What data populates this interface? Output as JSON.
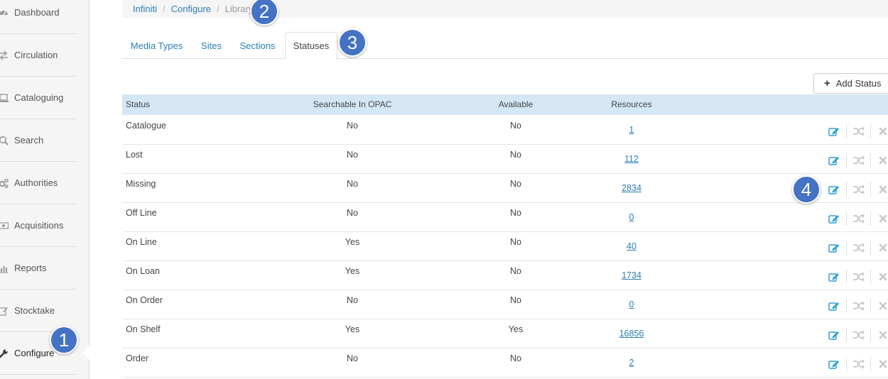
{
  "sidebar": {
    "items": [
      {
        "label": "Dashboard",
        "icon": "dashboard-icon"
      },
      {
        "label": "Circulation",
        "icon": "exchange-icon"
      },
      {
        "label": "Cataloguing",
        "icon": "laptop-icon"
      },
      {
        "label": "Search",
        "icon": "search-icon"
      },
      {
        "label": "Authorities",
        "icon": "cogs-icon"
      },
      {
        "label": "Acquisitions",
        "icon": "money-icon"
      },
      {
        "label": "Reports",
        "icon": "bar-chart-icon"
      },
      {
        "label": "Stocktake",
        "icon": "edit-icon"
      },
      {
        "label": "Configure",
        "icon": "wrench-icon",
        "active": true
      }
    ]
  },
  "breadcrumb": {
    "items": [
      "Infiniti",
      "Configure"
    ],
    "current": "Library"
  },
  "tabs": [
    {
      "label": "Media Types"
    },
    {
      "label": "Sites"
    },
    {
      "label": "Sections"
    },
    {
      "label": "Statuses",
      "active": true
    }
  ],
  "toolbar": {
    "add_label": "Add Status"
  },
  "table": {
    "headers": [
      "Status",
      "Searchable In OPAC",
      "Available",
      "Resources"
    ],
    "rows": [
      {
        "status": "Catalogue",
        "searchable": "No",
        "available": "No",
        "resources": "1"
      },
      {
        "status": "Lost",
        "searchable": "No",
        "available": "No",
        "resources": "112"
      },
      {
        "status": "Missing",
        "searchable": "No",
        "available": "No",
        "resources": "2834"
      },
      {
        "status": "Off Line",
        "searchable": "No",
        "available": "No",
        "resources": "0"
      },
      {
        "status": "On Line",
        "searchable": "Yes",
        "available": "No",
        "resources": "40"
      },
      {
        "status": "On Loan",
        "searchable": "Yes",
        "available": "No",
        "resources": "1734"
      },
      {
        "status": "On Order",
        "searchable": "No",
        "available": "No",
        "resources": "0"
      },
      {
        "status": "On Shelf",
        "searchable": "Yes",
        "available": "Yes",
        "resources": "16856"
      },
      {
        "status": "Order",
        "searchable": "No",
        "available": "No",
        "resources": "2"
      }
    ]
  },
  "callouts": [
    "1",
    "2",
    "3",
    "4"
  ],
  "colors": {
    "link": "#2a7db6",
    "header_bg": "#d5e7f5",
    "badge": "#4472c4",
    "edit_icon": "#2a9fd6",
    "disabled_icon": "#cccccc"
  }
}
